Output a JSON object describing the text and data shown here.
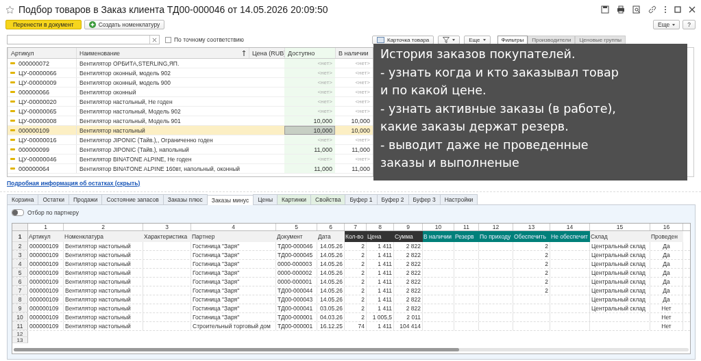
{
  "window": {
    "title": "Подбор товаров в Заказ клиента ТД00-000046 от 14.05.2026 20:09:50"
  },
  "toolbar": {
    "primary": "Перенести в документ",
    "create": "Создать номенклатуру",
    "more": "Еще",
    "help": "?"
  },
  "search": {
    "exact_match": {
      "label": "По точному соответствию",
      "checked": false
    }
  },
  "right_toolbar": {
    "card": "Карточка товара",
    "more": "Еще",
    "tabs": [
      {
        "label": "Фильтры",
        "selected": true
      },
      {
        "label": "Производители",
        "selected": false
      },
      {
        "label": "Ценовые группы",
        "selected": false
      }
    ]
  },
  "goods_table": {
    "columns": [
      "Артикул",
      "Наименование",
      "Цена (RUB)",
      "Доступно",
      "В наличии"
    ],
    "rows": [
      {
        "article": "000000072",
        "name": "Вентилятор ОРБИТА,STERLING,ЯП.",
        "available": "<нет>",
        "in_stock": "<нет>",
        "selected": false
      },
      {
        "article": "ЦУ-00000066",
        "name": "Вентилятор оконный, модель 902",
        "available": "<нет>",
        "in_stock": "<нет>",
        "selected": false
      },
      {
        "article": "ЦУ-00000009",
        "name": "Вентилятор оконный, модель 900",
        "available": "<нет>",
        "in_stock": "<нет>",
        "selected": false
      },
      {
        "article": "000000066",
        "name": "Вентилятор оконный",
        "available": "<нет>",
        "in_stock": "<нет>",
        "selected": false
      },
      {
        "article": "ЦУ-00000020",
        "name": "Вентилятор настольный, Не годен",
        "available": "<нет>",
        "in_stock": "<нет>",
        "selected": false
      },
      {
        "article": "ЦУ-00000065",
        "name": "Вентилятор настольный, Модель 902",
        "available": "<нет>",
        "in_stock": "<нет>",
        "selected": false
      },
      {
        "article": "ЦУ-00000008",
        "name": "Вентилятор настольный, Модель 901",
        "available": "10,000",
        "in_stock": "10,000",
        "selected": false
      },
      {
        "article": "000000109",
        "name": "Вентилятор настольный",
        "available": "10,000",
        "in_stock": "10,000",
        "selected": true
      },
      {
        "article": "ЦУ-00000016",
        "name": "Вентилятор JIPONIC (Тайв.),, Ограниченно годен",
        "available": "<нет>",
        "in_stock": "<нет>",
        "selected": false
      },
      {
        "article": "000000099",
        "name": "Вентилятор JIPONIC (Тайв.), напольный",
        "available": "11,000",
        "in_stock": "11,000",
        "selected": false
      },
      {
        "article": "ЦУ-00000046",
        "name": "Вентилятор BINATONE ALPINE, Не годен",
        "available": "<нет>",
        "in_stock": "<нет>",
        "selected": false
      },
      {
        "article": "000000064",
        "name": "Вентилятор BINATONE ALPINE 160вт, напольный, оконный",
        "available": "11,000",
        "in_stock": "11,000",
        "selected": false
      }
    ]
  },
  "stock_link": "Подробная информация об остатках (скрыть)",
  "note": {
    "lines": [
      "История заказов покупателей.",
      "- узнать когда и кто заказывал товар",
      "и по какой цене.",
      "- узнать активные заказы (в работе),",
      "какие заказы держат резерв.",
      "- выводит даже не проведенные",
      "заказы и выполненые"
    ]
  },
  "tabs": [
    {
      "label": "Корзина",
      "selected": false,
      "tinted": false
    },
    {
      "label": "Остатки",
      "selected": false,
      "tinted": false
    },
    {
      "label": "Продажи",
      "selected": false,
      "tinted": false
    },
    {
      "label": "Состояние запасов",
      "selected": false,
      "tinted": false
    },
    {
      "label": "Заказы плюс",
      "selected": false,
      "tinted": false
    },
    {
      "label": "Заказы минус",
      "selected": true,
      "tinted": false
    },
    {
      "label": "Цены",
      "selected": false,
      "tinted": false
    },
    {
      "label": "Картинки",
      "selected": false,
      "tinted": true
    },
    {
      "label": "Свойства",
      "selected": false,
      "tinted": true
    },
    {
      "label": "Буфер 1",
      "selected": false,
      "tinted": false
    },
    {
      "label": "Буфер 2",
      "selected": false,
      "tinted": false
    },
    {
      "label": "Буфер 3",
      "selected": false,
      "tinted": false
    },
    {
      "label": "Настройки",
      "selected": false,
      "tinted": false
    }
  ],
  "partner_filter": {
    "label": "Отбор по партнеру",
    "on": false
  },
  "sheet": {
    "column_numbers": [
      "1",
      "2",
      "3",
      "4",
      "5",
      "6",
      "7",
      "8",
      "9",
      "10",
      "11",
      "12",
      "13",
      "14",
      "15",
      "16"
    ],
    "header_row": "1",
    "headers": [
      {
        "label": "Артикул",
        "kind": "plain"
      },
      {
        "label": "Номенклатура",
        "kind": "plain"
      },
      {
        "label": "Характеристика",
        "kind": "plain"
      },
      {
        "label": "Партнер",
        "kind": "plain"
      },
      {
        "label": "Документ",
        "kind": "plain"
      },
      {
        "label": "Дата",
        "kind": "plain"
      },
      {
        "label": "Кол-во",
        "kind": "dark"
      },
      {
        "label": "Цена",
        "kind": "dark"
      },
      {
        "label": "Сумма",
        "kind": "dark"
      },
      {
        "label": "В наличии",
        "kind": "teal"
      },
      {
        "label": "Резерв",
        "kind": "teal"
      },
      {
        "label": "По приходу",
        "kind": "teal"
      },
      {
        "label": "Обеспечить",
        "kind": "teal"
      },
      {
        "label": "Не обеспечит",
        "kind": "teal"
      },
      {
        "label": "Склад",
        "kind": "plain"
      },
      {
        "label": "Проведен",
        "kind": "plain"
      }
    ],
    "rows": [
      {
        "num": "2",
        "article": "000000109",
        "item": "Вентилятор настольный",
        "partner": "Гостиница \"Заря\"",
        "document": "ТД00-000046",
        "date": "14.05.26",
        "qty": "2",
        "price": "1 411",
        "sum": "2 822",
        "provide": "2",
        "warehouse": "Центральный склад",
        "posted": "Да"
      },
      {
        "num": "3",
        "article": "000000109",
        "item": "Вентилятор настольный",
        "partner": "Гостиница \"Заря\"",
        "document": "ТД00-000045",
        "date": "14.05.26",
        "qty": "2",
        "price": "1 411",
        "sum": "2 822",
        "provide": "2",
        "warehouse": "Центральный склад",
        "posted": "Да"
      },
      {
        "num": "4",
        "article": "000000109",
        "item": "Вентилятор настольный",
        "partner": "Гостиница \"Заря\"",
        "document": "0000-000003",
        "date": "14.05.26",
        "qty": "2",
        "price": "1 411",
        "sum": "2 822",
        "provide": "2",
        "warehouse": "Центральный склад",
        "posted": "Да"
      },
      {
        "num": "5",
        "article": "000000109",
        "item": "Вентилятор настольный",
        "partner": "Гостиница \"Заря\"",
        "document": "0000-000002",
        "date": "14.05.26",
        "qty": "2",
        "price": "1 411",
        "sum": "2 822",
        "provide": "2",
        "warehouse": "Центральный склад",
        "posted": "Да"
      },
      {
        "num": "6",
        "article": "000000109",
        "item": "Вентилятор настольный",
        "partner": "Гостиница \"Заря\"",
        "document": "0000-000001",
        "date": "14.05.26",
        "qty": "2",
        "price": "1 411",
        "sum": "2 822",
        "provide": "2",
        "warehouse": "Центральный склад",
        "posted": "Да"
      },
      {
        "num": "7",
        "article": "000000109",
        "item": "Вентилятор настольный",
        "partner": "Гостиница \"Заря\"",
        "document": "ТД00-000044",
        "date": "14.05.26",
        "qty": "2",
        "price": "1 411",
        "sum": "2 822",
        "provide": "2",
        "warehouse": "Центральный склад",
        "posted": "Да"
      },
      {
        "num": "8",
        "article": "000000109",
        "item": "Вентилятор настольный",
        "partner": "Гостиница \"Заря\"",
        "document": "ТД00-000043",
        "date": "14.05.26",
        "qty": "2",
        "price": "1 411",
        "sum": "2 822",
        "warehouse": "Центральный склад",
        "posted": "Да"
      },
      {
        "num": "9",
        "article": "000000109",
        "item": "Вентилятор настольный",
        "partner": "Гостиница \"Заря\"",
        "document": "ТД00-000041",
        "date": "03.05.26",
        "qty": "2",
        "price": "1 411",
        "sum": "2 822",
        "warehouse": "Центральный склад",
        "posted": "Нет"
      },
      {
        "num": "10",
        "article": "000000109",
        "item": "Вентилятор настольный",
        "partner": "Гостиница \"Заря\"",
        "document": "ТД00-000001",
        "date": "04.03.26",
        "qty": "2",
        "price": "1 005,5",
        "sum": "2 011",
        "posted": "Нет"
      },
      {
        "num": "11",
        "article": "000000109",
        "item": "Вентилятор настольный",
        "partner": "Строительный торговый дом",
        "document": "ТД00-000001",
        "date": "16.12.25",
        "qty": "74",
        "price": "1 411",
        "sum": "104 414",
        "posted": "Нет"
      }
    ],
    "empty_rows": [
      "12",
      "13"
    ]
  }
}
